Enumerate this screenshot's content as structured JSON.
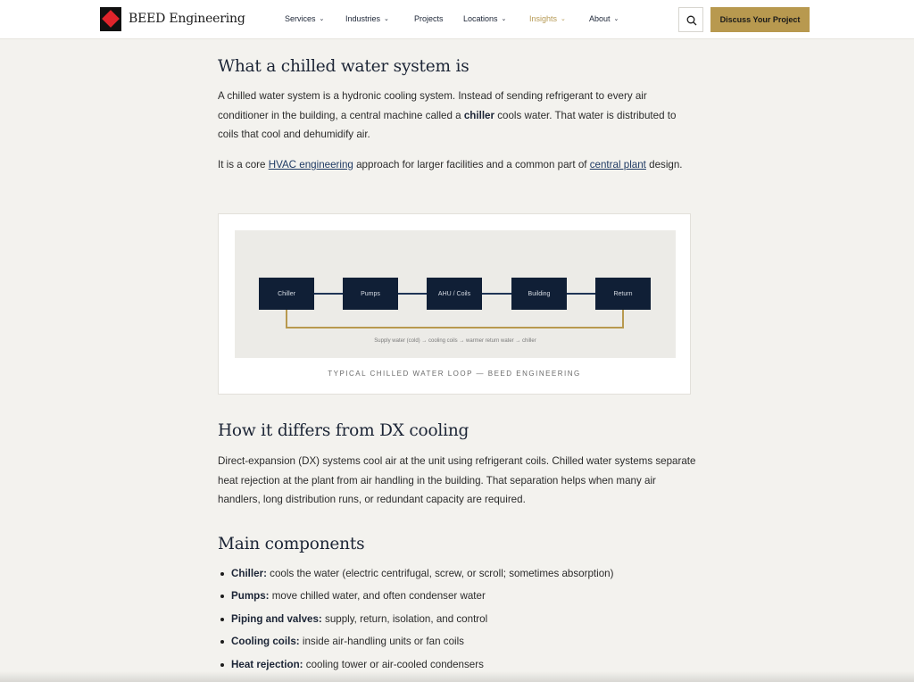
{
  "header": {
    "brand": "BEED Engineering",
    "nav": [
      {
        "label": "Services",
        "dropdown": true
      },
      {
        "label": "Industries",
        "dropdown": true
      },
      {
        "label": "Projects",
        "dropdown": false
      },
      {
        "label": "Locations",
        "dropdown": true
      },
      {
        "label": "Insights",
        "dropdown": true
      },
      {
        "label": "About",
        "dropdown": true
      }
    ],
    "active_nav": "Insights",
    "cta": "Discuss Your Project",
    "search_icon": "search-icon"
  },
  "section1": {
    "title": "What a chilled water system is",
    "p1_a": "A chilled water system is a hydronic cooling system. Instead of sending refrigerant to every air conditioner in the building, a central machine called a ",
    "p1_bold": "chiller",
    "p1_b": " cools water. That water is distributed to coils that cool and dehumidify air.",
    "p2_a": "It is a core ",
    "p2_link1": "HVAC engineering",
    "p2_b": " approach for larger facilities and a common part of ",
    "p2_link2": "central plant",
    "p2_c": " design."
  },
  "figure": {
    "boxes": [
      "Chiller",
      "Pumps",
      "AHU / Coils",
      "Building",
      "Return"
    ],
    "note": "Supply water (cold) → cooling coils → warmer return water → chiller",
    "caption": "TYPICAL CHILLED WATER LOOP — BEED ENGINEERING",
    "colors": {
      "box": "#101f36",
      "loop": "#b8994f"
    }
  },
  "section2": {
    "title": "How it differs from DX cooling",
    "p": "Direct-expansion (DX) systems cool air at the unit using refrigerant coils. Chilled water systems separate heat rejection at the plant from air handling in the building. That separation helps when many air handlers, long distribution runs, or redundant capacity are required."
  },
  "section3": {
    "title": "Main components",
    "items": [
      {
        "term": "Chiller:",
        "desc": " cools the water (electric centrifugal, screw, or scroll; sometimes absorption)"
      },
      {
        "term": "Pumps:",
        "desc": " move chilled water, and often condenser water"
      },
      {
        "term": "Piping and valves:",
        "desc": " supply, return, isolation, and control"
      },
      {
        "term": "Cooling coils:",
        "desc": " inside air-handling units or fan coils"
      },
      {
        "term": "Heat rejection:",
        "desc": " cooling tower or air-cooled condensers"
      }
    ]
  },
  "colors": {
    "accent": "#b8994f",
    "navy": "#1c2536",
    "background": "#f3f2ee"
  }
}
